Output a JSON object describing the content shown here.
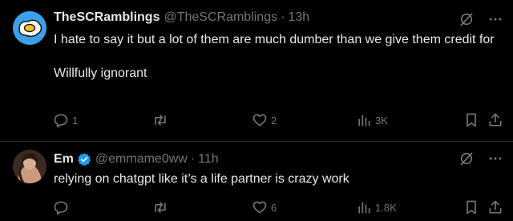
{
  "tweets": [
    {
      "name": "TheSCRamblings",
      "handle": "@TheSCRamblings",
      "separator": "·",
      "time": "13h",
      "verified": false,
      "avatar_icon": "fried-egg-avatar",
      "paragraphs": [
        "I hate to say it but a lot of them are much dumber than we give them credit for",
        "Willfully ignorant"
      ],
      "replies": "1",
      "retweets": "",
      "likes": "2",
      "views": "3K"
    },
    {
      "name": "Em",
      "handle": "@emmame0ww",
      "separator": "·",
      "time": "11h",
      "verified": true,
      "avatar_icon": "profile-photo-avatar",
      "paragraphs": [
        "relying on chatgpt like it’s a life partner is crazy work"
      ],
      "replies": "",
      "retweets": "",
      "likes": "6",
      "views": "1.8K"
    }
  ],
  "colors": {
    "background": "#000000",
    "text": "#e7e9ea",
    "muted": "#71767b",
    "divider": "#2f3336",
    "verified": "#1d9bf0"
  }
}
